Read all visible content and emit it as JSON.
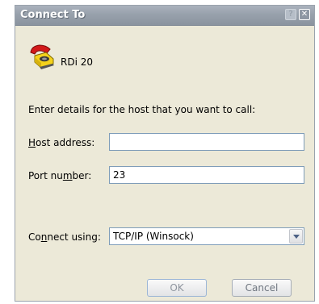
{
  "window": {
    "title": "Connect To"
  },
  "session": {
    "name": "RDi 20",
    "icon": "telephone-icon"
  },
  "instruction": "Enter details for the host that you want to call:",
  "host": {
    "label_prefix": "",
    "label_key": "H",
    "label_rest": "ost address:",
    "value": ""
  },
  "port": {
    "label_prefix": "Port nu",
    "label_key": "m",
    "label_rest": "ber:",
    "value": "23"
  },
  "connect": {
    "label_prefix": "Co",
    "label_key": "n",
    "label_rest": "nect using:",
    "selected": "TCP/IP (Winsock)"
  },
  "buttons": {
    "ok": "OK",
    "cancel": "Cancel"
  },
  "colors": {
    "titlebar": "#98a1ac",
    "dialog_bg": "#ece9d8",
    "field_border": "#7f9db9"
  }
}
